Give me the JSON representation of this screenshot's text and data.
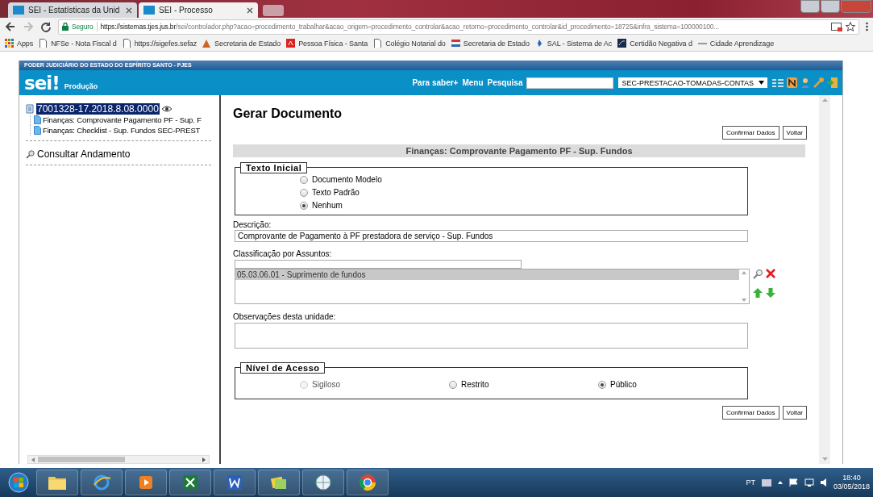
{
  "browser": {
    "tabs": [
      {
        "title": "SEI - Estatísticas da Unid",
        "selected": false
      },
      {
        "title": "SEI - Processo",
        "selected": true
      }
    ],
    "address": {
      "secure_label": "Seguro",
      "url_host": "https://sistemas.tjes.jus.br",
      "url_path": "/sei/controlador.php?acao=procedimento_trabalhar&acao_origem=procedimento_controlar&acao_retorno=procedimento_controlar&id_procedimento=18725&infra_sistema=100000100..."
    },
    "apps_label": "Apps",
    "bookmarks": [
      {
        "label": "NFSe - Nota Fiscal d",
        "kind": "page"
      },
      {
        "label": "https://sigefes.sefaz",
        "kind": "page"
      },
      {
        "label": "Secretaria de Estado",
        "kind": "triangle"
      },
      {
        "label": "Pessoa Física - Santa",
        "kind": "red"
      },
      {
        "label": "Colégio Notarial do",
        "kind": "page"
      },
      {
        "label": "Secretaria de Estado",
        "kind": "flag"
      },
      {
        "label": "SAL - Sistema de Ac",
        "kind": "pin"
      },
      {
        "label": "Certidão Negativa d",
        "kind": "dark"
      },
      {
        "label": "Cidade Aprendizage",
        "kind": "dash"
      }
    ]
  },
  "header": {
    "org": "PODER JUDICIÁRIO DO ESTADO DO ESPÍRITO SANTO - PJES",
    "logo": "sei",
    "logo_mark": "!",
    "environment": "Produção",
    "links": [
      "Para saber+",
      "Menu",
      "Pesquisa"
    ],
    "unit": "SEC-PRESTACAO-TOMADAS-CONTAS"
  },
  "tree": {
    "label": "7001328-17.2018.8.08.0000",
    "selected": true,
    "children": [
      {
        "label": "Finanças: Comprovante Pagamento PF - Sup. F"
      },
      {
        "label": "Finanças: Checklist - Sup. Fundos SEC-PREST"
      }
    ]
  },
  "side_link": "Consultar Andamento",
  "form": {
    "title": "Gerar Documento",
    "buttons": [
      "Confirmar Dados",
      "Voltar"
    ],
    "document_type": "Finanças: Comprovante Pagamento PF - Sup. Fundos",
    "texto_inicial": {
      "legend": "Texto Inicial",
      "options": [
        {
          "label": "Documento Modelo",
          "selected": false
        },
        {
          "label": "Texto Padrão",
          "selected": false
        },
        {
          "label": "Nenhum",
          "selected": true
        }
      ]
    },
    "descricao": {
      "label": "Descrição:",
      "value": "Comprovante de Pagamento à PF prestadora de serviço - Sup. Fundos"
    },
    "classificacao": {
      "label": "Classificação por Assuntos:",
      "items": [
        {
          "label": "05.03.06.01 - Suprimento de fundos",
          "selected": true
        }
      ]
    },
    "observacoes": {
      "label": "Observações desta unidade:"
    },
    "nivel_acesso": {
      "legend": "Nível de Acesso",
      "options": [
        {
          "label": "Sigiloso",
          "selected": false,
          "disabled": true
        },
        {
          "label": "Restrito",
          "selected": false,
          "disabled": false
        },
        {
          "label": "Público",
          "selected": true,
          "disabled": false
        }
      ]
    },
    "bottom_buttons": [
      "Confirmar Dados",
      "Voltar"
    ]
  },
  "taskbar": {
    "language": "PT",
    "time": "18:40",
    "date": "03/05/2018"
  }
}
